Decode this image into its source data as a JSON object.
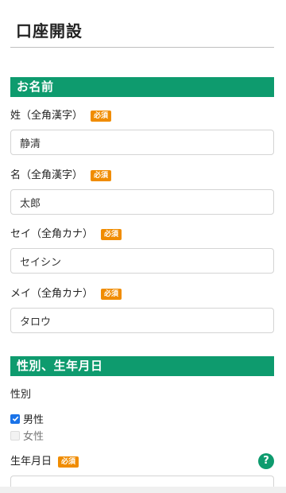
{
  "page": {
    "title": "口座開設"
  },
  "sections": {
    "name": {
      "heading": "お名前"
    },
    "gender_birth": {
      "heading": "性別、生年月日"
    }
  },
  "required_label": "必須",
  "fields": {
    "last_name_kanji": {
      "label": "姓（全角漢字）",
      "value": "静清"
    },
    "first_name_kanji": {
      "label": "名（全角漢字）",
      "value": "太郎"
    },
    "last_name_kana": {
      "label": "セイ（全角カナ）",
      "value": "セイシン"
    },
    "first_name_kana": {
      "label": "メイ（全角カナ）",
      "value": "タロウ"
    },
    "gender": {
      "label": "性別",
      "options": [
        {
          "label": "男性",
          "checked": true
        },
        {
          "label": "女性",
          "checked": false
        }
      ]
    },
    "birthdate": {
      "label": "生年月日",
      "help_glyph": "?"
    }
  },
  "colors": {
    "accent_green": "#0e9b6e",
    "required_orange": "#f08c00",
    "checkbox_blue": "#1a73e8"
  },
  "icons": {
    "help": "question-circle-icon",
    "checkmark": "checkmark-icon"
  }
}
